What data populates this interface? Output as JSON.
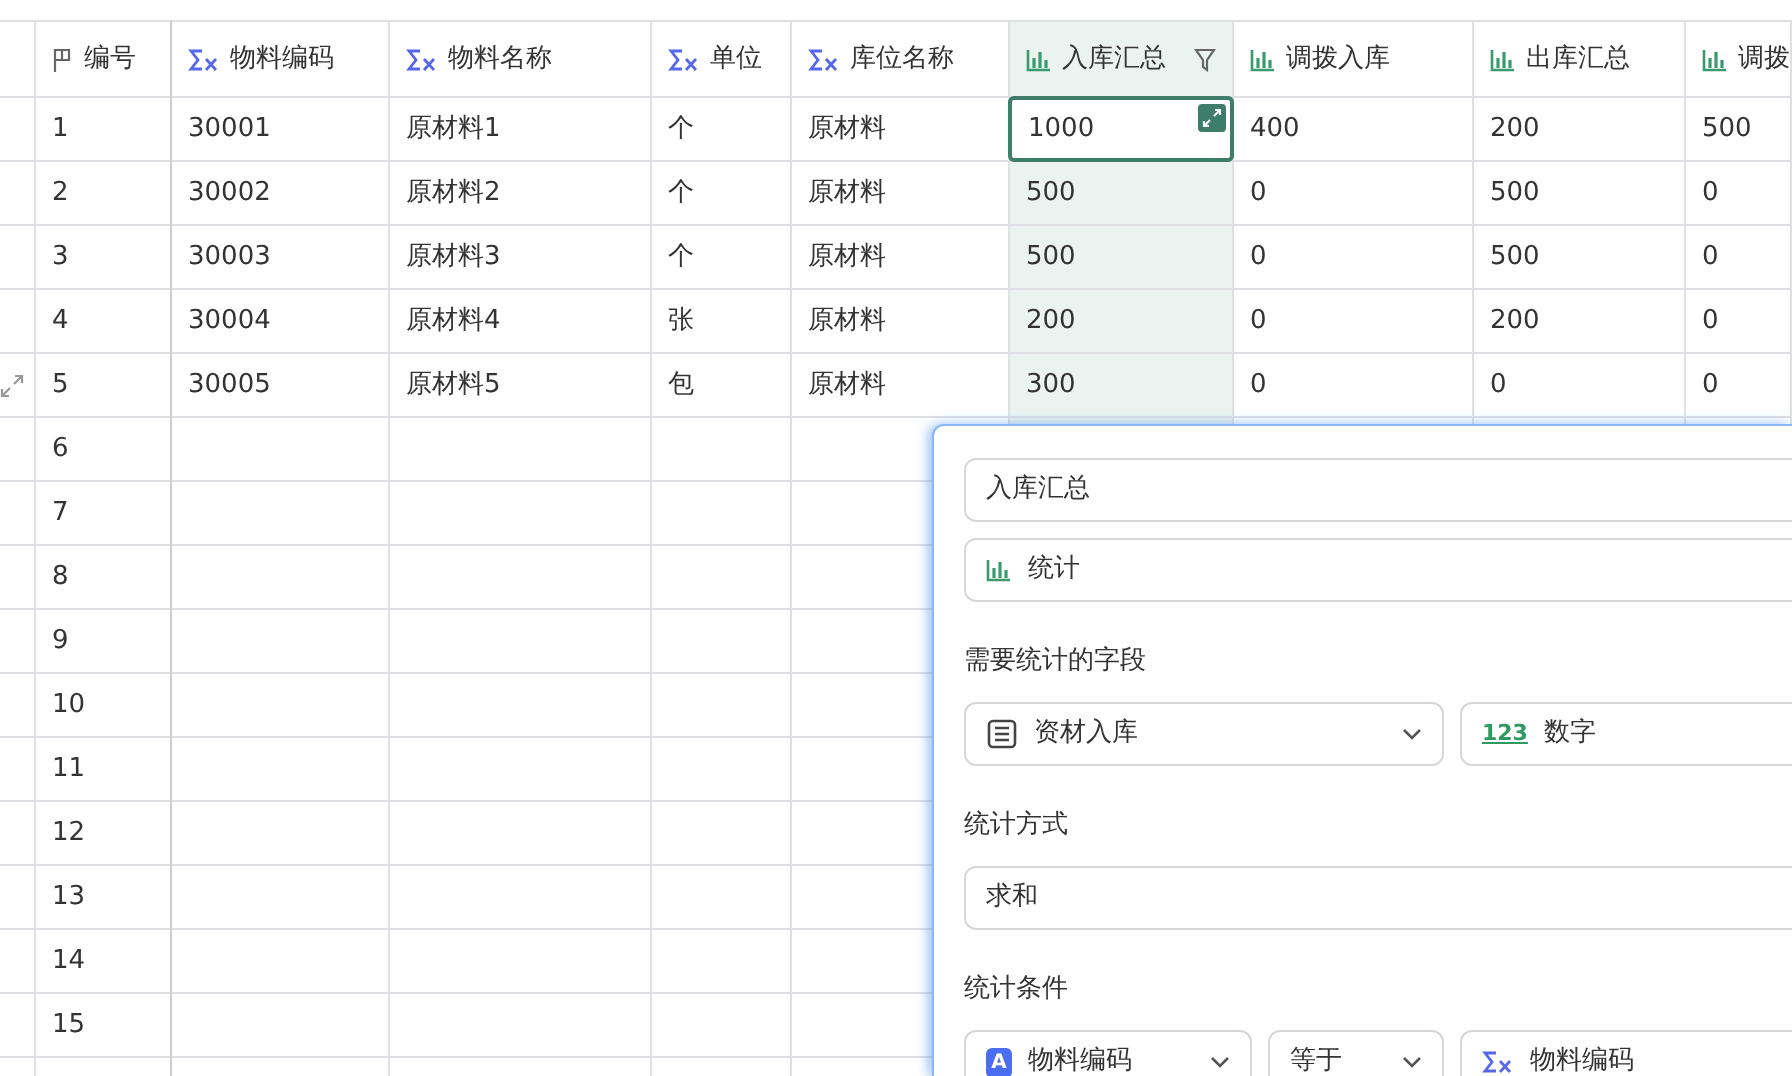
{
  "table": {
    "columns": [
      {
        "label": "编号",
        "kind": "flag",
        "selected": false,
        "filter": false
      },
      {
        "label": "物料编码",
        "kind": "formula",
        "selected": false,
        "filter": false
      },
      {
        "label": "物料名称",
        "kind": "formula",
        "selected": false,
        "filter": false
      },
      {
        "label": "单位",
        "kind": "formula",
        "selected": false,
        "filter": false
      },
      {
        "label": "库位名称",
        "kind": "formula",
        "selected": false,
        "filter": false
      },
      {
        "label": "入库汇总",
        "kind": "stats",
        "selected": true,
        "filter": true
      },
      {
        "label": "调拨入库",
        "kind": "stats",
        "selected": false,
        "filter": false
      },
      {
        "label": "出库汇总",
        "kind": "stats",
        "selected": false,
        "filter": false
      },
      {
        "label": "调拨",
        "kind": "stats",
        "selected": false,
        "filter": false
      }
    ],
    "rows": [
      {
        "cells": [
          "1",
          "30001",
          "原材料1",
          "个",
          "原材料",
          "1000",
          "400",
          "200",
          "500"
        ],
        "active": true,
        "expand_handle": false
      },
      {
        "cells": [
          "2",
          "30002",
          "原材料2",
          "个",
          "原材料",
          "500",
          "0",
          "500",
          "0"
        ],
        "active": false,
        "expand_handle": false
      },
      {
        "cells": [
          "3",
          "30003",
          "原材料3",
          "个",
          "原材料",
          "500",
          "0",
          "500",
          "0"
        ],
        "active": false,
        "expand_handle": false
      },
      {
        "cells": [
          "4",
          "30004",
          "原材料4",
          "张",
          "原材料",
          "200",
          "0",
          "200",
          "0"
        ],
        "active": false,
        "expand_handle": false
      },
      {
        "cells": [
          "5",
          "30005",
          "原材料5",
          "包",
          "原材料",
          "300",
          "0",
          "0",
          "0"
        ],
        "active": false,
        "expand_handle": true
      },
      {
        "cells": [
          "6"
        ],
        "active": false,
        "expand_handle": false
      },
      {
        "cells": [
          "7"
        ],
        "active": false,
        "expand_handle": false
      },
      {
        "cells": [
          "8"
        ],
        "active": false,
        "expand_handle": false
      },
      {
        "cells": [
          "9"
        ],
        "active": false,
        "expand_handle": false
      },
      {
        "cells": [
          "10"
        ],
        "active": false,
        "expand_handle": false
      },
      {
        "cells": [
          "11"
        ],
        "active": false,
        "expand_handle": false
      },
      {
        "cells": [
          "12"
        ],
        "active": false,
        "expand_handle": false
      },
      {
        "cells": [
          "13"
        ],
        "active": false,
        "expand_handle": false
      },
      {
        "cells": [
          "14"
        ],
        "active": false,
        "expand_handle": false
      },
      {
        "cells": [
          "15"
        ],
        "active": false,
        "expand_handle": false
      }
    ]
  },
  "panel": {
    "field_name": {
      "value": "入库汇总"
    },
    "field_type": {
      "kind": "stats_select",
      "value": "统计"
    },
    "sections": [
      {
        "label": "需要统计的字段",
        "controls": [
          {
            "kind": "table_select",
            "value": "资材入库"
          },
          {
            "kind": "number_value",
            "icon_text": "123",
            "value": "数字"
          }
        ]
      },
      {
        "label": "统计方式",
        "controls": [
          {
            "kind": "input",
            "value": "求和"
          }
        ]
      },
      {
        "label": "统计条件",
        "controls": [
          {
            "kind": "letter_select",
            "icon_text": "A",
            "value": "物料编码"
          },
          {
            "kind": "select",
            "value": "等于"
          },
          {
            "kind": "formula_value",
            "value": "物料编码"
          }
        ]
      }
    ]
  }
}
